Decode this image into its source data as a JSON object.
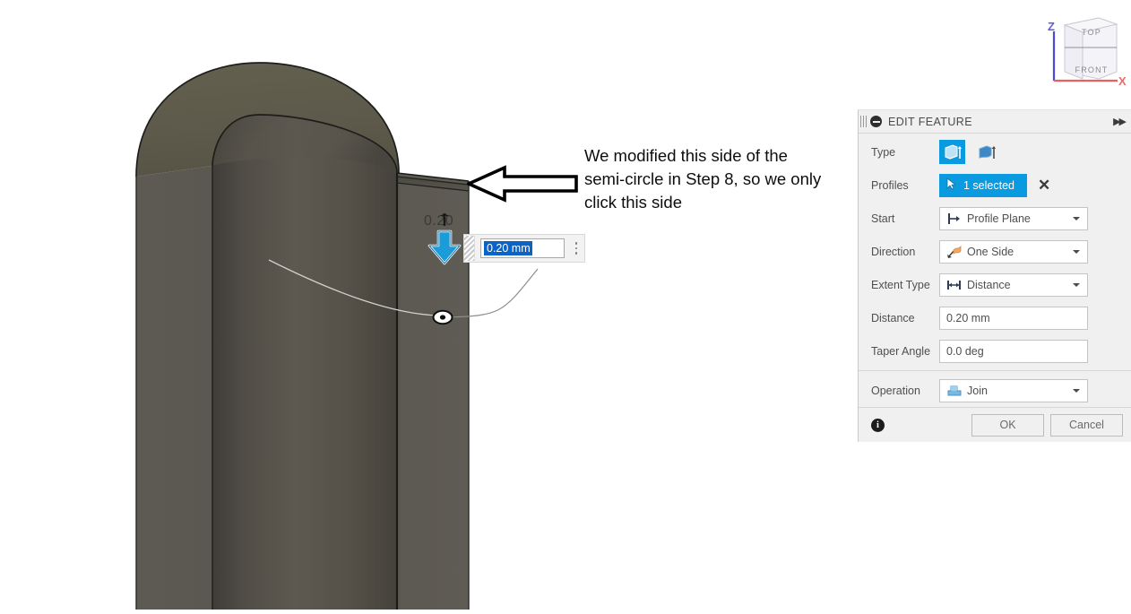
{
  "viewport": {
    "name": "3d-viewport",
    "background": "#ffffff",
    "model": {
      "description": "Extruded semi-circular rounded-top solid body",
      "top_face_color": "#5e5d50",
      "side_face_color": "#5f5c54",
      "cylinder_face_color": "#56534c",
      "edge_color": "#232320"
    }
  },
  "viewcube": {
    "top_face_label": "TOP",
    "front_face_label": "FRONT",
    "axis_z_label": "Z",
    "axis_x_label": "X",
    "axis_z_color": "#4a4ad8",
    "axis_x_color": "#e8605f",
    "cube_face_color": "#f4f4f8"
  },
  "annotation": {
    "arrow_icon": "left-arrow-icon",
    "text": "We modified this side of the semi-circle in Step 8, so we only click this side",
    "text_color": "#0d0d0d"
  },
  "dimension_editor": {
    "grip_icon": "drag-grip-icon",
    "value": "0.20 mm",
    "selected": true,
    "selection_color": "#0a64c8",
    "kebab_icon": "more-options-icon"
  },
  "manipulator": {
    "arrow_icon": "extrude-drag-arrow-icon",
    "arrow_color": "#1b9bd8",
    "label": "0.20",
    "point_marker_icon": "midpoint-marker-icon"
  },
  "panel": {
    "grip_icon": "panel-grip-icon",
    "collapse_icon": "collapse-circle-icon",
    "title": "EDIT FEATURE",
    "expand_icon": "expand-double-chevron-icon",
    "rows": {
      "type": {
        "label": "Type",
        "options": [
          {
            "icon": "extrude-flat-icon",
            "selected": true
          },
          {
            "icon": "extrude-tapered-icon",
            "selected": false
          }
        ]
      },
      "profiles": {
        "label": "Profiles",
        "cursor_icon": "select-cursor-icon",
        "value": "1 selected",
        "clear_icon": "clear-x-icon",
        "accent": "#0a9ae0"
      },
      "start": {
        "label": "Start",
        "icon": "profile-plane-icon",
        "value": "Profile Plane"
      },
      "direction": {
        "label": "Direction",
        "icon": "one-side-flag-icon",
        "value": "One Side"
      },
      "extent_type": {
        "label": "Extent Type",
        "icon": "distance-arrows-icon",
        "value": "Distance"
      },
      "distance": {
        "label": "Distance",
        "value": "0.20 mm"
      },
      "taper_angle": {
        "label": "Taper Angle",
        "value": "0.0 deg"
      },
      "operation": {
        "label": "Operation",
        "icon": "join-operation-icon",
        "value": "Join"
      }
    },
    "footer": {
      "info_icon": "info-icon",
      "info_glyph": "i",
      "ok_label": "OK",
      "cancel_label": "Cancel"
    }
  }
}
